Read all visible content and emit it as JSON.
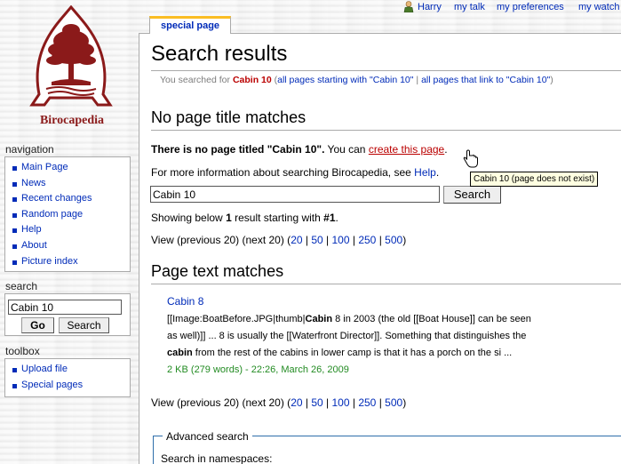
{
  "personal": {
    "username": "Harry",
    "talk": "my talk",
    "preferences": "my preferences",
    "watchlist": "my watch"
  },
  "logo": {
    "text": "Birocapedia"
  },
  "tabs": [
    {
      "label": "special page"
    }
  ],
  "sidebar": {
    "navigation_title": "navigation",
    "navigation_items": [
      {
        "label": "Main Page"
      },
      {
        "label": "News"
      },
      {
        "label": "Recent changes"
      },
      {
        "label": "Random page"
      },
      {
        "label": "Help"
      },
      {
        "label": "About"
      },
      {
        "label": "Picture index"
      }
    ],
    "search_title": "search",
    "search_value": "Cabin 10",
    "go_label": "Go",
    "search_label": "Search",
    "toolbox_title": "toolbox",
    "toolbox_items": [
      {
        "label": "Upload file"
      },
      {
        "label": "Special pages"
      }
    ]
  },
  "main": {
    "title": "Search results",
    "subtitle_prefix": "You searched for",
    "subtitle_query": "Cabin 10",
    "subtitle_open": "(",
    "subtitle_link1": "all pages starting with \"Cabin 10\"",
    "subtitle_sep": "|",
    "subtitle_link2": "all pages that link to \"Cabin 10\"",
    "subtitle_close": ")",
    "heading_title_matches": "No page title matches",
    "no_page_bold": "There is no page titled \"Cabin 10\".",
    "you_can": "You can",
    "create_link": "create this page",
    "period": ".",
    "more_info": "For more information about searching Birocapedia, see",
    "help_link": "Help",
    "search_value": "Cabin 10",
    "search_button": "Search",
    "showing_prefix": "Showing below",
    "showing_count": "1",
    "showing_mid": "result starting with",
    "showing_start": "#1",
    "showing_end": ".",
    "pager": {
      "prefix": "View (previous 20) (next 20) (",
      "links": [
        "20",
        "50",
        "100",
        "250",
        "500"
      ],
      "suffix": ")"
    },
    "heading_text_matches": "Page text matches",
    "result": {
      "title": "Cabin 8",
      "line1_a": "[[Image:BoatBefore.JPG|thumb|",
      "line1_b": "Cabin",
      "line1_c": " 8 in 2003 (the old [[Boat House]] can be seen",
      "line2": "as well)]] ... 8 is usually the [[Waterfront Director]]. Something that distinguishes the",
      "line3_a": "cabin",
      "line3_b": " from the rest of the cabins in lower camp is that it has a porch on the si ...",
      "meta": "2 KB (279 words) - 22:26, March 26, 2009"
    },
    "advanced_legend": "Advanced search",
    "namespaces_label": "Search in namespaces:",
    "tooltip": "Cabin 10 (page does not exist)"
  },
  "colors": {
    "link": "#002bb8",
    "new_link": "#ba0000",
    "tab_accent": "#fabd23",
    "result_meta": "#228b22"
  }
}
